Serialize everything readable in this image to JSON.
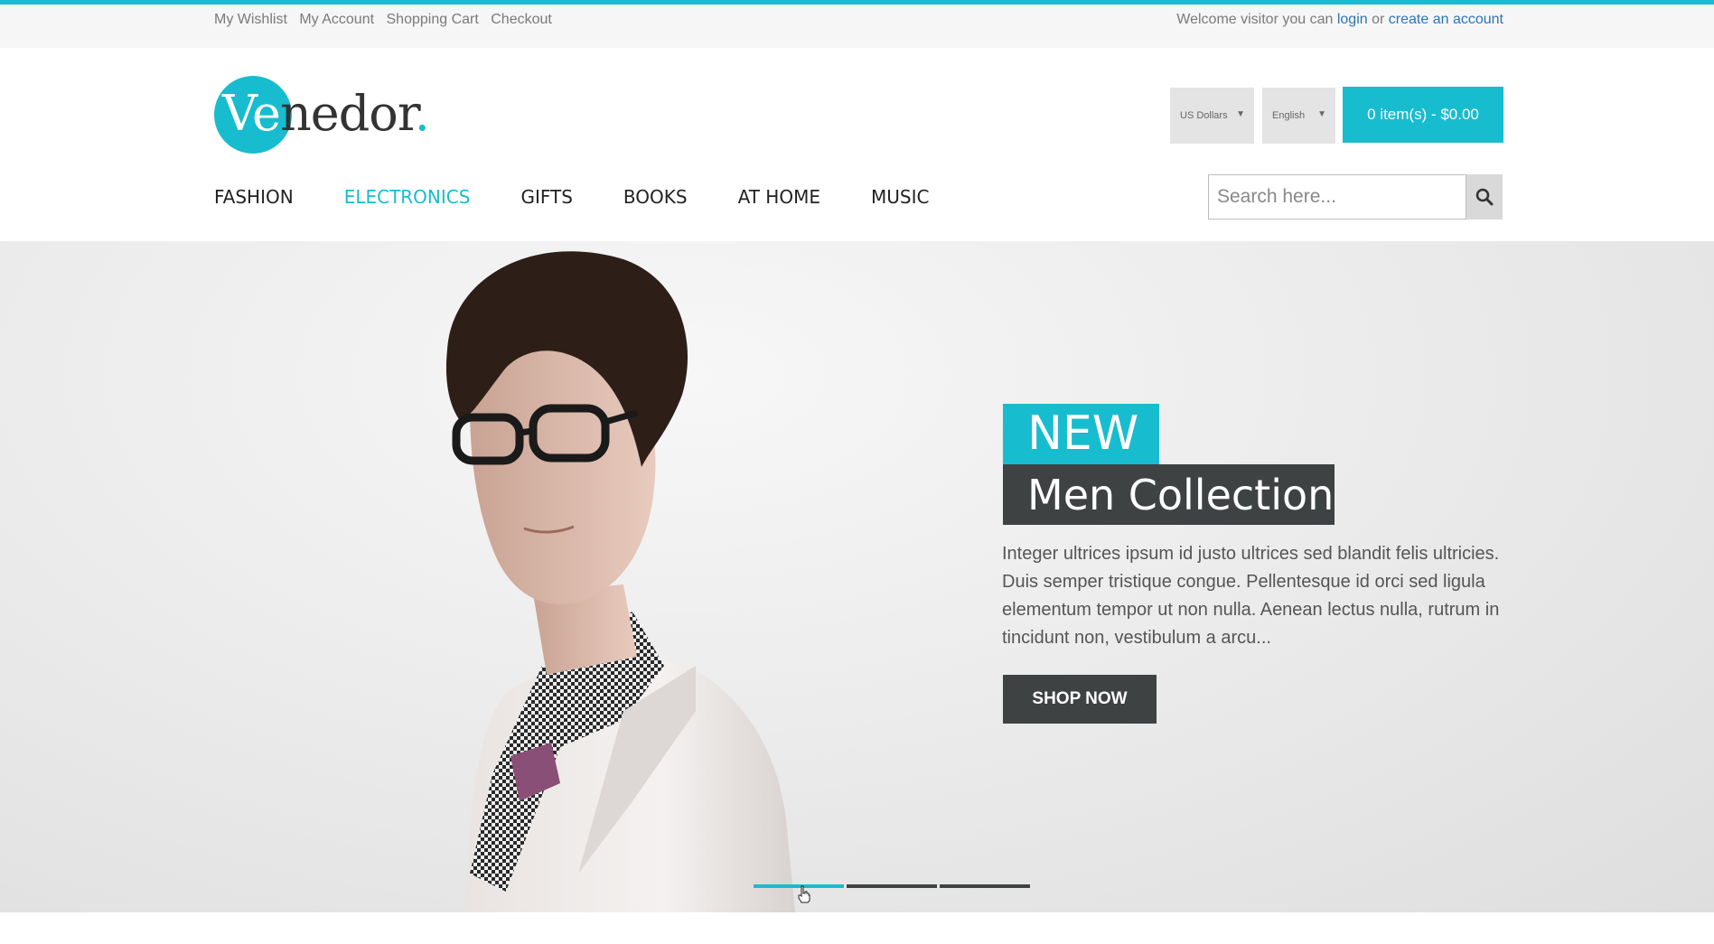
{
  "topbar": {
    "links": [
      "My Wishlist",
      "My Account",
      "Shopping Cart",
      "Checkout"
    ],
    "welcome_text": "Welcome visitor you can",
    "login_label": "login",
    "or_text": "or",
    "create_account_label": "create an account"
  },
  "header": {
    "logo": {
      "prefix": "Ve",
      "suffix": "nedor",
      "dot": "."
    },
    "currency": "US Dollars",
    "language": "English",
    "cart_label": "0 item(s) - $0.00"
  },
  "nav": {
    "items": [
      "FASHION",
      "ELECTRONICS",
      "GIFTS",
      "BOOKS",
      "AT HOME",
      "MUSIC"
    ],
    "active_index": 1
  },
  "search": {
    "placeholder": "Search here...",
    "icon": "search-icon"
  },
  "hero": {
    "badge_new": "NEW",
    "title": "Men Collection",
    "description": "Integer ultrices ipsum id justo ultrices sed blandit felis ultricies. Duis semper tristique congue. Pellentesque id orci sed ligula elementum tempor ut non nulla. Aenean lectus nulla, rutrum in tincidunt non, vestibulum a arcu...",
    "button_label": "SHOP NOW",
    "slides": 3,
    "active_slide": 1
  },
  "colors": {
    "accent": "#18bccf",
    "dark": "#3f4243",
    "link": "#2f74b5"
  }
}
